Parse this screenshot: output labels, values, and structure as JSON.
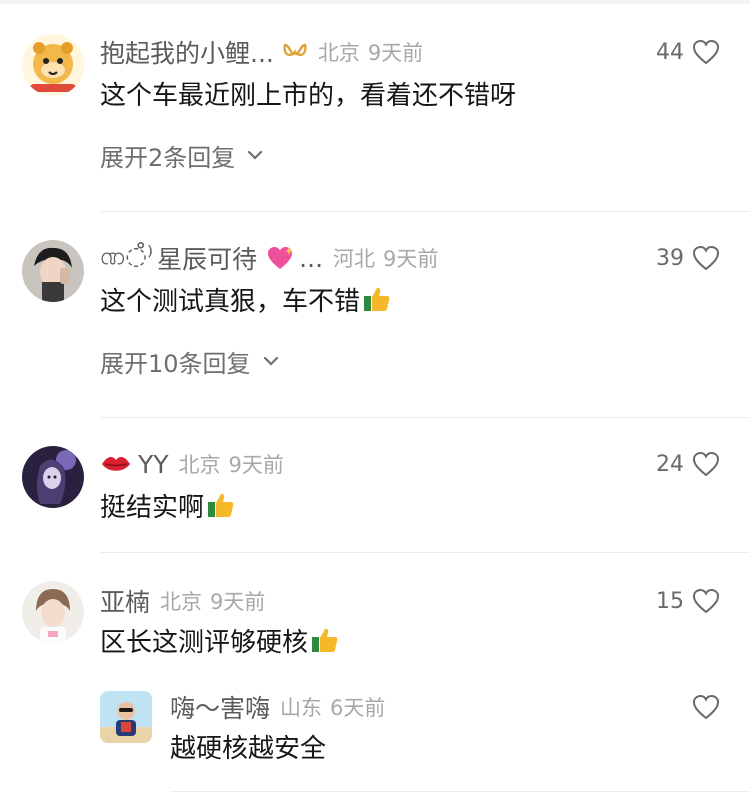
{
  "comments": [
    {
      "username": "抱起我的小鲤...",
      "location": "北京",
      "time": "9天前",
      "text": "这个车最近刚上市的，看着还不错呀",
      "likes": "44",
      "expand": "展开2条回复"
    },
    {
      "username_prefix": "ဏ◌̊⁾",
      "username": "星辰可待",
      "username_suffix": "...",
      "location": "河北",
      "time": "9天前",
      "text": "这个测试真狠，车不错",
      "likes": "39",
      "expand": "展开10条回复"
    },
    {
      "username": "YY",
      "location": "北京",
      "time": "9天前",
      "text": "挺结实啊",
      "likes": "24"
    },
    {
      "username": "亚楠",
      "location": "北京",
      "time": "9天前",
      "text": "区长这测评够硬核",
      "likes": "15",
      "reply": {
        "username": "嗨～害嗨",
        "location": "山东",
        "time": "6天前",
        "text": "越硬核越安全",
        "likes": ""
      }
    }
  ],
  "icons": {
    "heart": "heart-outline-icon",
    "thumbs_up": "thumbs-up-emoji",
    "badge": "gold-loop-badge-icon",
    "sparkle_heart": "sparkling-heart-emoji",
    "lips": "kiss-lips-emoji",
    "chevron": "chevron-down-icon"
  },
  "colors": {
    "username": "#5b5b5b",
    "meta": "#a8a8a8",
    "text": "#161616",
    "expand": "#6e6e6e"
  }
}
